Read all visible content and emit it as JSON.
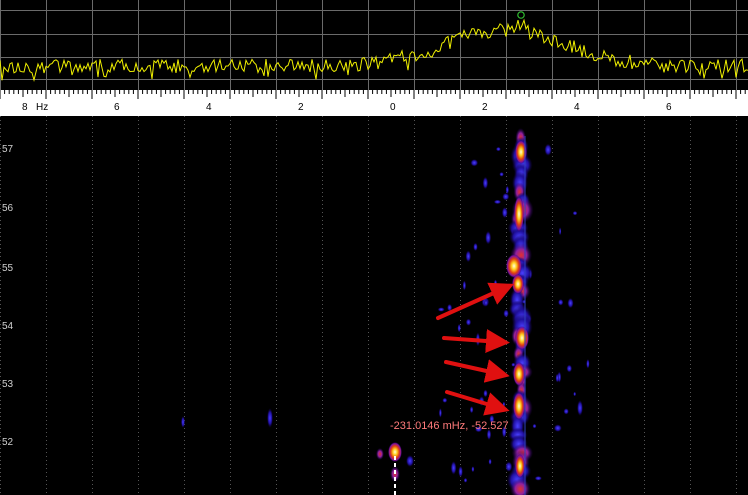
{
  "frequency_axis": {
    "unit": "Hz",
    "tick_labels": [
      {
        "label": "8",
        "value": -8
      },
      {
        "label": "6",
        "value": -6
      },
      {
        "label": "4",
        "value": -4
      },
      {
        "label": "2",
        "value": -2
      },
      {
        "label": "0",
        "value": 0
      },
      {
        "label": "2",
        "value": 2
      },
      {
        "label": "4",
        "value": 4
      },
      {
        "label": "6",
        "value": 6
      }
    ]
  },
  "time_axis": {
    "tick_labels": [
      "57",
      "56",
      "55",
      "54",
      "53",
      "52"
    ]
  },
  "cursor_readout": {
    "text": "-231.0146 mHz, -52.527"
  },
  "colors": {
    "spectrum_trace": "#f0f000",
    "peak_marker": "#30c030",
    "grid": "#6a6a6a",
    "annotation_arrow": "#e01010",
    "readout_text": "#ff7a7a"
  },
  "annotations": {
    "arrow_count": 4
  }
}
